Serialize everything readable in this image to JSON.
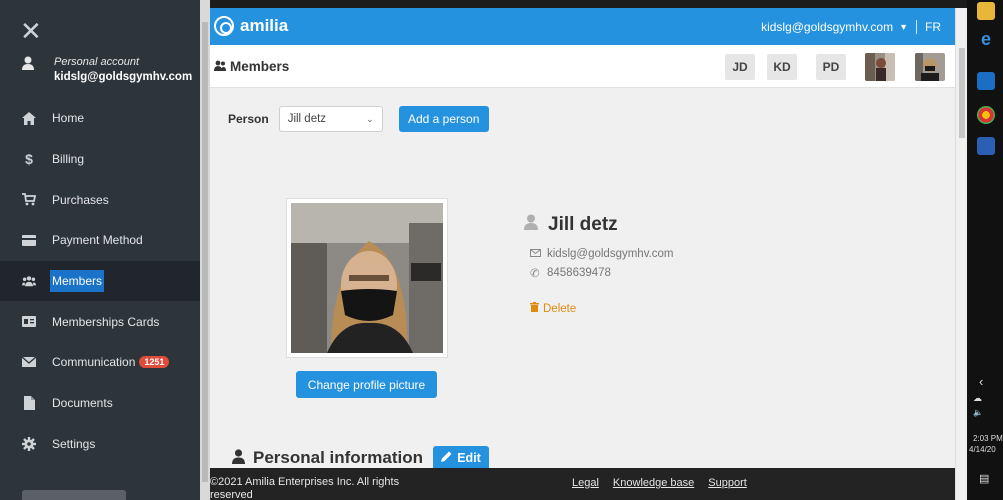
{
  "sidebar": {
    "close_glyph": "✕",
    "account_title": "Personal account",
    "account_email": "kidslg@goldsgymhv.com",
    "items": [
      {
        "label": "Home",
        "icon": "home-icon"
      },
      {
        "label": "Billing",
        "icon": "dollar-icon"
      },
      {
        "label": "Purchases",
        "icon": "cart-icon"
      },
      {
        "label": "Payment Method",
        "icon": "credit-card-icon"
      },
      {
        "label": "Members",
        "icon": "users-icon",
        "active": true
      },
      {
        "label": "Memberships Cards",
        "icon": "id-card-icon"
      },
      {
        "label": "Communication",
        "icon": "envelope-icon",
        "badge": "1251"
      },
      {
        "label": "Documents",
        "icon": "document-icon"
      },
      {
        "label": "Settings",
        "icon": "gear-icon"
      }
    ]
  },
  "topbar": {
    "brand": "amilia",
    "user_email": "kidslg@goldsgymhv.com",
    "lang": "FR"
  },
  "subbar": {
    "title": "Members",
    "chips": [
      "JD",
      "KD",
      "PD"
    ]
  },
  "person_row": {
    "label": "Person",
    "selected": "Jill detz",
    "add_button": "Add a person"
  },
  "profile": {
    "name": "Jill detz",
    "email": "kidslg@goldsgymhv.com",
    "phone": "8458639478",
    "delete_label": "Delete",
    "change_picture": "Change profile picture"
  },
  "personal": {
    "heading": "Personal information",
    "edit_label": "Edit"
  },
  "footer": {
    "copyright": "©2021 Amilia Enterprises Inc. All rights reserved",
    "links": [
      "Legal",
      "Knowledge base",
      "Support"
    ]
  },
  "taskbar": {
    "time": "2:03 PM",
    "date": "4/14/20"
  },
  "colors": {
    "brand_blue": "#2592e0",
    "sidebar_bg": "#2d343a",
    "delete_orange": "#e08a12",
    "badge_red": "#e04b3a"
  }
}
